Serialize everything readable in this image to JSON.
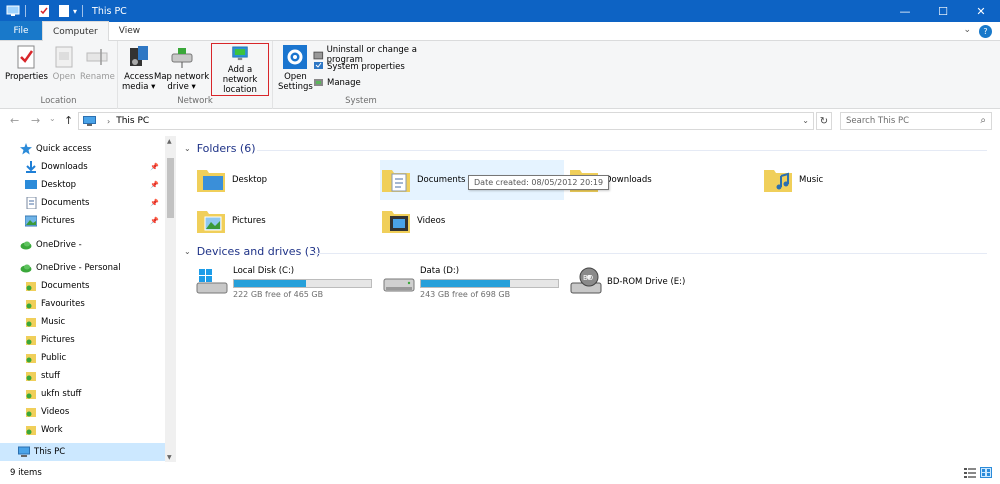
{
  "window": {
    "title": "This PC",
    "minimize": "—",
    "maximize": "☐",
    "close": "✕"
  },
  "ribbon": {
    "tabs": [
      {
        "label": "File"
      },
      {
        "label": "Computer"
      },
      {
        "label": "View"
      }
    ],
    "expand_label": "⌄",
    "help_label": "?",
    "groups": {
      "location": {
        "label": "Location",
        "properties": "Properties",
        "open": "Open",
        "rename": "Rename"
      },
      "network": {
        "label": "Network",
        "access_media_1": "Access",
        "access_media_2": "media ▾",
        "map_drive_1": "Map network",
        "map_drive_2": "drive ▾",
        "add_location_1": "Add a network",
        "add_location_2": "location"
      },
      "system": {
        "label": "System",
        "open_settings_1": "Open",
        "open_settings_2": "Settings",
        "uninstall": "Uninstall or change a program",
        "system_properties": "System properties",
        "manage": "Manage"
      }
    }
  },
  "navigation": {
    "back": "←",
    "forward": "→",
    "recent": "⌄",
    "up": "↑",
    "address_path": "This PC",
    "address_chevron": "›",
    "address_dropdown": "⌄",
    "refresh": "↻",
    "search_placeholder": "Search This PC",
    "search_icon": "⌕"
  },
  "nav_pane": {
    "quick_access": "Quick access",
    "quick_items": [
      {
        "label": "Downloads",
        "pinned": true
      },
      {
        "label": "Desktop",
        "pinned": true
      },
      {
        "label": "Documents",
        "pinned": true
      },
      {
        "label": "Pictures",
        "pinned": true
      }
    ],
    "pin_glyph": "📌",
    "onedrive": "OneDrive -",
    "onedrive_personal": "OneDrive - Personal",
    "onedrive_items": [
      {
        "label": "Documents"
      },
      {
        "label": "Favourites"
      },
      {
        "label": "Music"
      },
      {
        "label": "Pictures"
      },
      {
        "label": "Public"
      },
      {
        "label": "stuff"
      },
      {
        "label": "ukfn stuff"
      },
      {
        "label": "Videos"
      },
      {
        "label": "Work"
      }
    ],
    "this_pc": "This PC",
    "scroll_up": "▲",
    "scroll_down": "▼"
  },
  "content": {
    "folders_header": "Folders (6)",
    "folders": [
      {
        "name": "Desktop"
      },
      {
        "name": "Documents"
      },
      {
        "name": "Downloads"
      },
      {
        "name": "Music"
      },
      {
        "name": "Pictures"
      },
      {
        "name": "Videos"
      }
    ],
    "tooltip": "Date created: 08/05/2012 20:19",
    "devices_header": "Devices and drives (3)",
    "drives": [
      {
        "name": "Local Disk (C:)",
        "free": "222 GB free of 465 GB",
        "used_fraction": 0.523
      },
      {
        "name": "Data (D:)",
        "free": "243 GB free of 698 GB",
        "used_fraction": 0.652
      },
      {
        "name": "BD-ROM Drive (E:)"
      }
    ]
  },
  "status": {
    "items_count": "9 items"
  },
  "colors": {
    "titlebar": "#0d63c4",
    "file_tab": "#1979ca",
    "selection": "#cce8ff",
    "drive_bar": "#26a0da",
    "header_text": "#1e3287",
    "highlight_box": "#d8262a"
  }
}
